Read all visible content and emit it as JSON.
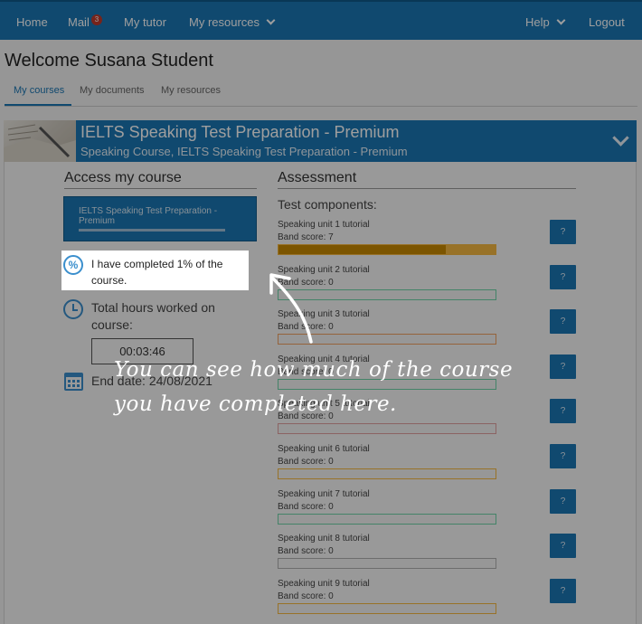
{
  "nav": {
    "home": "Home",
    "mail": "Mail",
    "mail_count": "3",
    "my_tutor": "My tutor",
    "my_resources": "My resources",
    "help": "Help",
    "logout": "Logout"
  },
  "welcome": "Welcome Susana Student",
  "subtabs": [
    "My courses",
    "My documents",
    "My resources"
  ],
  "course": {
    "title": "IELTS Speaking Test Preparation - Premium",
    "subtitle": "Speaking Course, IELTS Speaking Test Preparation - Premium"
  },
  "access": {
    "heading": "Access my course",
    "button_label": "IELTS Speaking Test Preparation - Premium",
    "completed_text": "I have completed 1% of the course.",
    "completed_percent": 1,
    "hours_label": "Total hours worked on course:",
    "hours_value": "00:03:46",
    "end_date": "End date: 24/08/2021"
  },
  "assessment": {
    "heading": "Assessment",
    "components_label": "Test components:",
    "help_label": "?",
    "units": [
      {
        "name": "Speaking unit 1 tutorial",
        "score": "Band score: 7",
        "fill": 0.77,
        "color": "#f5b942",
        "dark": "#c98a00"
      },
      {
        "name": "Speaking unit 2 tutorial",
        "score": "Band score: 0",
        "fill": 0,
        "color": "#6fd3a8"
      },
      {
        "name": "Speaking unit 3 tutorial",
        "score": "Band score: 0",
        "fill": 0,
        "color": "#f0a060"
      },
      {
        "name": "Speaking unit 4 tutorial",
        "score": "Band score: 0",
        "fill": 0,
        "color": "#6fd3a8"
      },
      {
        "name": "Speaking unit 5 tutorial",
        "score": "Band score: 0",
        "fill": 0,
        "color": "#e0a0a0"
      },
      {
        "name": "Speaking unit 6 tutorial",
        "score": "Band score: 0",
        "fill": 0,
        "color": "#f5b942"
      },
      {
        "name": "Speaking unit 7 tutorial",
        "score": "Band score: 0",
        "fill": 0,
        "color": "#6fd3a8"
      },
      {
        "name": "Speaking unit 8 tutorial",
        "score": "Band score: 0",
        "fill": 0,
        "color": "#b0b0b0"
      },
      {
        "name": "Speaking unit 9 tutorial",
        "score": "Band score: 0",
        "fill": 0,
        "color": "#f5b942"
      }
    ]
  },
  "hint": "You can see how much of the course you have completed here.",
  "icons": {
    "percent": "%",
    "clock": "clock-icon",
    "calendar": "calendar-icon",
    "chevron": "chevron-down-icon"
  }
}
